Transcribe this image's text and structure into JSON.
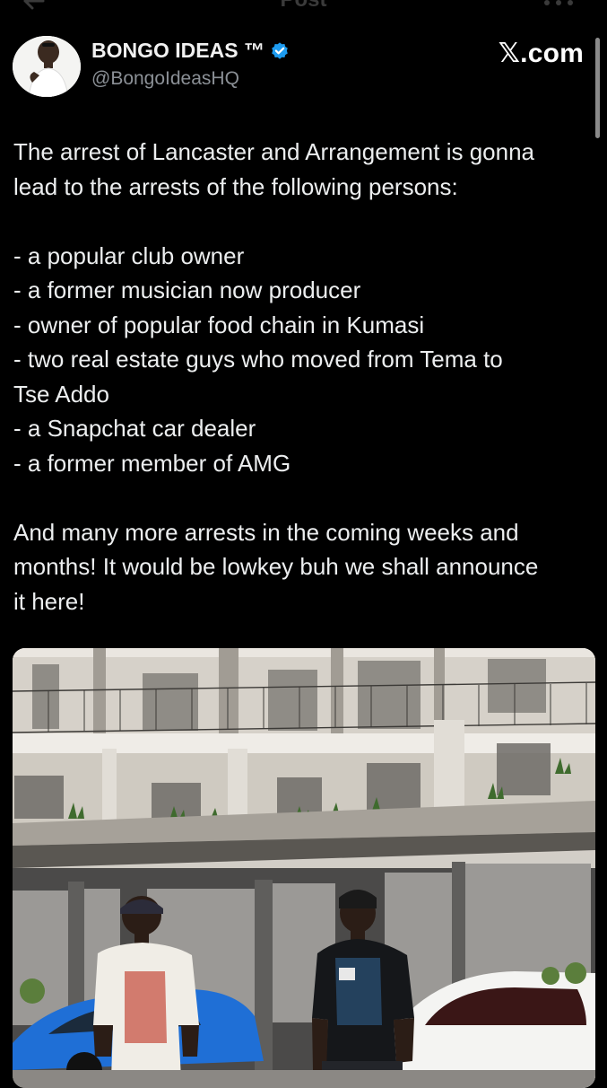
{
  "topbar": {
    "title": "Post",
    "back_icon": "arrow-left-icon",
    "more_icon": "more-horizontal-icon"
  },
  "author": {
    "display_name": "BONGO IDEAS ™",
    "handle": "@BongoIdeasHQ",
    "verified_icon": "verified-badge-icon",
    "verified_color": "#1d9bf0"
  },
  "watermark": {
    "text": "𝕏.com"
  },
  "tweet": {
    "intro": [
      "The arrest of Lancaster and Arrangement is gonna",
      "lead to the arrests of the following persons:"
    ],
    "list": [
      "- a popular club owner",
      "- a former musician now producer",
      "- owner of popular food chain in Kumasi",
      "- two real estate guys who moved from Tema to",
      "Tse Addo",
      "- a Snapchat car dealer",
      "- a former member of AMG"
    ],
    "outro": [
      "And many more arrests in the coming weeks and",
      "months! It would be lowkey buh we shall announce",
      "it here!"
    ]
  },
  "media": {
    "kind": "photo"
  },
  "colors": {
    "background": "#000000",
    "text": "#e7e9ea",
    "muted": "#8b9096",
    "accent": "#1d9bf0"
  }
}
